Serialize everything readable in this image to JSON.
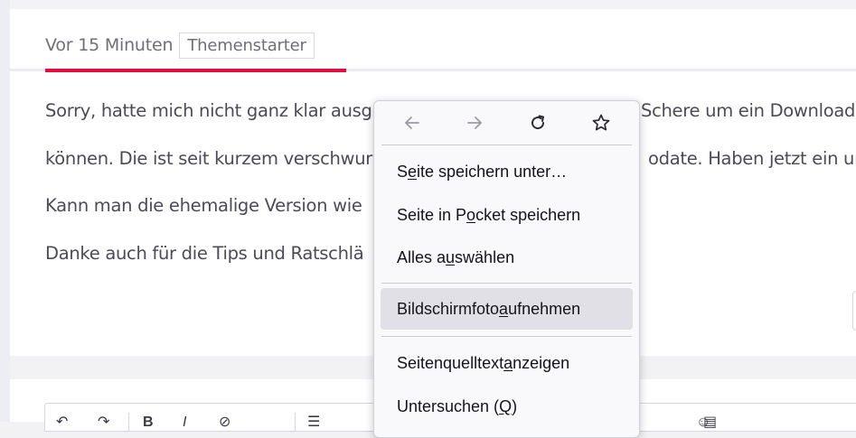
{
  "post": {
    "time": "Vor 15 Minuten",
    "badge": "Themenstarter",
    "lines": [
      "Sorry, hatte mich nicht ganz klar ausg",
      "können. Die ist seit kurzem verschwur",
      "Kann man die ehemalige Version wie",
      "Danke auch für die Tips und Ratschlä"
    ],
    "lines_right": [
      "Schere um ein Download",
      "odate. Haben jetzt ein um"
    ]
  },
  "context_menu": {
    "nav_icons": [
      "back-arrow-icon",
      "forward-arrow-icon",
      "reload-icon",
      "bookmark-star-icon"
    ],
    "items": [
      {
        "pre": "S",
        "key": "e",
        "post": "ite speichern unter…"
      },
      {
        "pre": "Seite in P",
        "key": "o",
        "post": "cket speichern"
      },
      {
        "pre": "Alles a",
        "key": "u",
        "post": "swählen"
      },
      {
        "pre": "Bildschirmfoto ",
        "key": "a",
        "post": "ufnehmen"
      },
      {
        "pre": "Seitenquelltext ",
        "key": "a",
        "post": "nzeigen"
      },
      {
        "pre": "Untersuchen (",
        "key": "Q",
        "post": ")"
      }
    ]
  },
  "colors": {
    "accent": "#e30e3e",
    "menu_highlight": "#e0e0e6"
  }
}
